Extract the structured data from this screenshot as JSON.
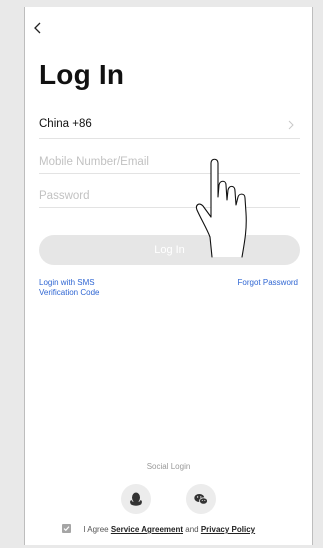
{
  "header": {
    "title": "Log In",
    "back_icon": "chevron-left-icon"
  },
  "form": {
    "country": {
      "value": "China +86",
      "icon": "chevron-right-icon"
    },
    "mobile": {
      "placeholder": "Mobile Number/Email",
      "value": ""
    },
    "password": {
      "placeholder": "Password",
      "value": ""
    },
    "login_button": "Log In"
  },
  "links": {
    "sms_login": "Login with SMS Verification Code",
    "forgot_password": "Forgot Password"
  },
  "social": {
    "label": "Social Login",
    "providers": [
      {
        "name": "qq",
        "icon": "qq-penguin-icon"
      },
      {
        "name": "wechat",
        "icon": "wechat-icon"
      }
    ]
  },
  "agreement": {
    "checked": true,
    "prefix": "I Agree",
    "service_agreement": "Service Agreement",
    "and": "and",
    "privacy_policy": "Privacy Policy"
  },
  "colors": {
    "link": "#2f66d3",
    "button_disabled": "#e6e6e6",
    "background": "#ffffff"
  }
}
